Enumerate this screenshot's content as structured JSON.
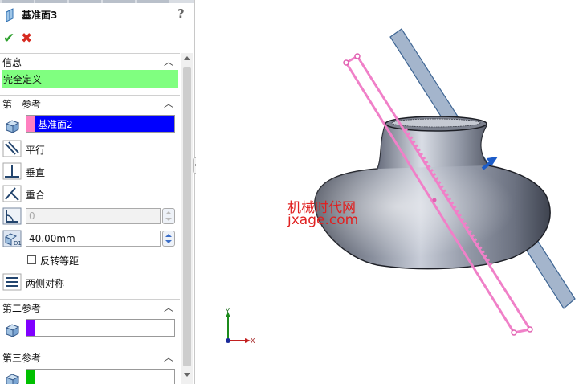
{
  "title": "基准面3",
  "help_label": "?",
  "sections": {
    "info": {
      "header": "信息",
      "status": "完全定义"
    },
    "first_ref": {
      "header": "第一参考",
      "selection": "基准面2",
      "swatch_color": "#ff80c0",
      "options": {
        "parallel": "平行",
        "perpendicular": "垂直",
        "coincident": "重合"
      },
      "angle_value": "0",
      "distance_value": "40.00mm",
      "flip_offset": "反转等距",
      "mid_plane": "两侧对称"
    },
    "second_ref": {
      "header": "第二参考",
      "swatch_color": "#8000ff"
    },
    "third_ref": {
      "header": "第三参考",
      "swatch_color": "#00c000"
    }
  },
  "viewport": {
    "watermark_line1": "机械时代网",
    "watermark_line2": "jxage.com",
    "triad": {
      "y_label": "Y",
      "x_label": "X"
    }
  },
  "colors": {
    "status_bg": "#80ff80",
    "selection_bg": "#0000ff",
    "preview_plane": "#f080c8",
    "reference_plane": "#6f8fb8",
    "watermark": "#e02020"
  }
}
